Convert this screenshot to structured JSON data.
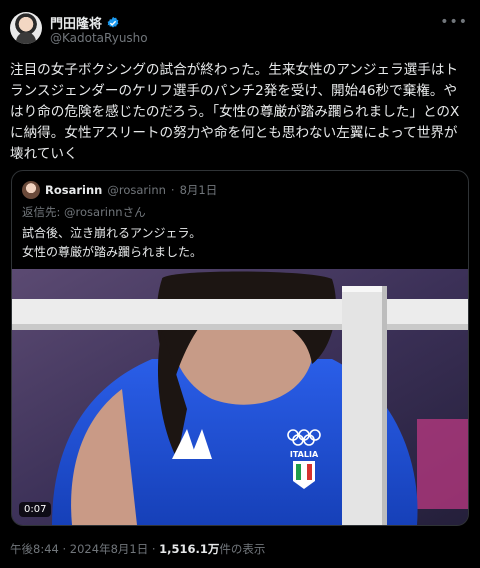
{
  "author": {
    "display_name": "門田隆将",
    "handle": "@KadotaRyusho"
  },
  "tweet": {
    "text": "注目の女子ボクシングの試合が終わった。生来女性のアンジェラ選手はトランスジェンダーのケリフ選手のパンチ2発を受け、開始46秒で棄権。やはり命の危険を感じたのだろう。「女性の尊厳が踏み躙られました」とのXに納得。女性アスリートの努力や命を何とも思わない左翼によって世界が壊れていく"
  },
  "quote": {
    "display_name": "Rosarinn",
    "handle": "@rosarinn",
    "separator": "·",
    "date": "8月1日",
    "reply_to": "返信先: @rosarinnさん",
    "text": "試合後、泣き崩れるアンジェラ。\n女性の尊厳が踏み躙られました。",
    "video_time": "0:07",
    "jersey_text": "ITALIA"
  },
  "meta": {
    "time": "午後8:44",
    "separator1": "·",
    "date": "2024年8月1日",
    "separator2": "·",
    "views": "1,516.1万",
    "views_label": "件の表示"
  },
  "colors": {
    "background": "#000000",
    "text": "#e7e9ea",
    "secondary": "#71767b",
    "verified": "#1d9bf0",
    "border": "#2f3336",
    "jersey": "#1d4fd0"
  },
  "icons": [
    "verified-badge-icon",
    "more-options-icon"
  ]
}
